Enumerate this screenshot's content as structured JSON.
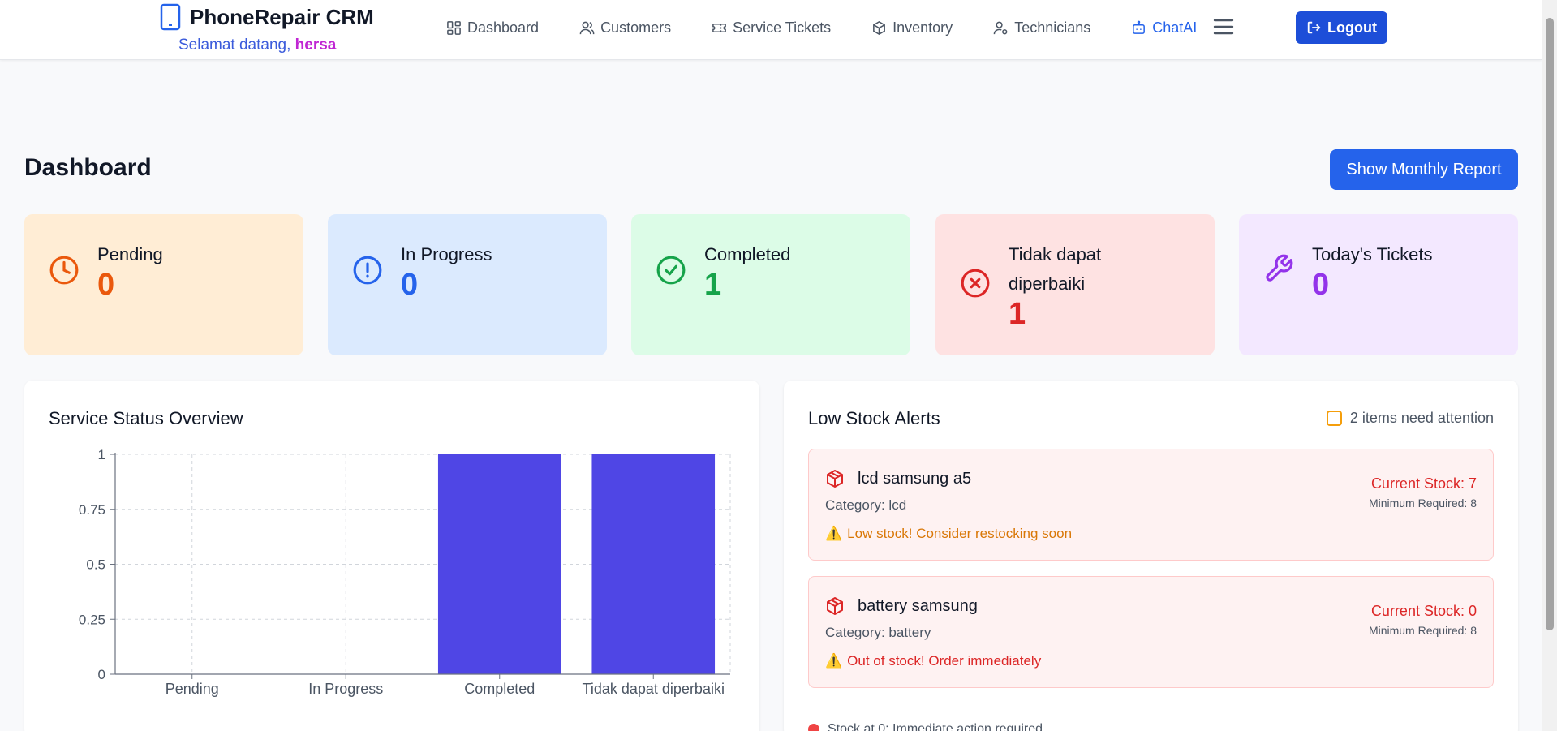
{
  "app": {
    "name": "PhoneRepair CRM",
    "welcome_prefix": "Selamat datang,",
    "user": "hersa"
  },
  "nav": {
    "items": [
      {
        "label": "Dashboard",
        "icon": "dashboard-grid-icon"
      },
      {
        "label": "Customers",
        "icon": "users-icon"
      },
      {
        "label": "Service Tickets",
        "icon": "ticket-icon"
      },
      {
        "label": "Inventory",
        "icon": "package-icon"
      },
      {
        "label": "Technicians",
        "icon": "user-gear-icon"
      },
      {
        "label": "ChatAI",
        "icon": "bot-icon"
      }
    ],
    "menu_icon": "hamburger-menu-icon",
    "logout_label": "Logout"
  },
  "page": {
    "title": "Dashboard",
    "report_button": "Show Monthly Report"
  },
  "stats": [
    {
      "label": "Pending",
      "value": "0",
      "icon": "clock-icon",
      "bg": "#ffedd5",
      "color": "#ea580c"
    },
    {
      "label": "In Progress",
      "value": "0",
      "icon": "alert-circle-icon",
      "bg": "#dbeafe",
      "color": "#2563eb"
    },
    {
      "label": "Completed",
      "value": "1",
      "icon": "check-circle-icon",
      "bg": "#dcfce7",
      "color": "#16a34a"
    },
    {
      "label": "Tidak dapat diperbaiki",
      "value": "1",
      "icon": "x-circle-icon",
      "bg": "#fee2e2",
      "color": "#dc2626"
    },
    {
      "label": "Today's Tickets",
      "value": "0",
      "icon": "wrench-icon",
      "bg": "#f3e8ff",
      "color": "#9333ea"
    }
  ],
  "status_panel": {
    "title": "Service Status Overview"
  },
  "chart_data": {
    "type": "bar",
    "categories": [
      "Pending",
      "In Progress",
      "Completed",
      "Tidak dapat diperbaiki"
    ],
    "values": [
      0,
      0,
      1,
      1
    ],
    "ylim": [
      0,
      1
    ],
    "yticks": [
      "0",
      "0.25",
      "0.5",
      "0.75",
      "1"
    ],
    "grid": true,
    "bar_color": "#4f46e5"
  },
  "stock_panel": {
    "title": "Low Stock Alerts",
    "attention": "2 items need attention",
    "items": [
      {
        "name": "lcd samsung a5",
        "category": "Category: lcd",
        "message": "Low stock! Consider restocking soon",
        "message_color": "#d97706",
        "stock": "Current Stock: 7",
        "minimum": "Minimum Required: 8"
      },
      {
        "name": "battery samsung",
        "category": "Category: battery",
        "message": "Out of stock! Order immediately",
        "message_color": "#dc2626",
        "stock": "Current Stock: 0",
        "minimum": "Minimum Required: 8"
      }
    ],
    "legend": "Stock at 0: Immediate action required"
  }
}
